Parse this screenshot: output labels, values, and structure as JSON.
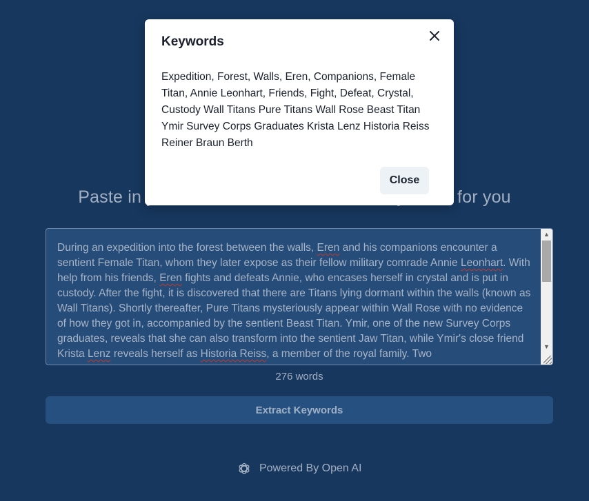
{
  "main": {
    "heading": "Paste in your text and we'll extract the keywords for you",
    "textarea_paragraph": "During an expedition into the forest between the walls, Eren and his companions encounter a sentient Female Titan, whom they later expose as their fellow military comrade Annie Leonhart. With help from his friends, Eren fights and defeats Annie, who encases herself in crystal and is put in custody. After the fight, it is discovered that there are Titans lying dormant within the walls (known as Wall Titans). Shortly thereafter, Pure Titans mysteriously appear within Wall Rose with no evidence of how they got in, accompanied by the sentient Beast Titan. Ymir, one of the new Survey Corps graduates, reveals that she can also transform into the sentient Jaw Titan, while Ymir's close friend Krista Lenz reveals herself as Historia Reiss, a member of the royal family. Two",
    "word_count": "276 words",
    "extract_button": "Extract Keywords"
  },
  "footer": {
    "text": "Powered By Open AI",
    "logo_icon": "openai-logo-icon"
  },
  "modal": {
    "title": "Keywords",
    "keywords": "Expedition, Forest, Walls, Eren, Companions, Female Titan, Annie Leonhart, Friends, Fight, Defeat, Crystal, Custody Wall Titans Pure Titans Wall Rose Beast Titan Ymir Survey Corps Graduates Krista Lenz Historia Reiss Reiner Braun Berth",
    "close_button": "Close",
    "close_icon": "close-x-icon"
  },
  "colors": {
    "background": "#17375e",
    "textarea_bg": "#264c7a",
    "button_bg": "#26507f",
    "modal_bg": "#ffffff"
  }
}
